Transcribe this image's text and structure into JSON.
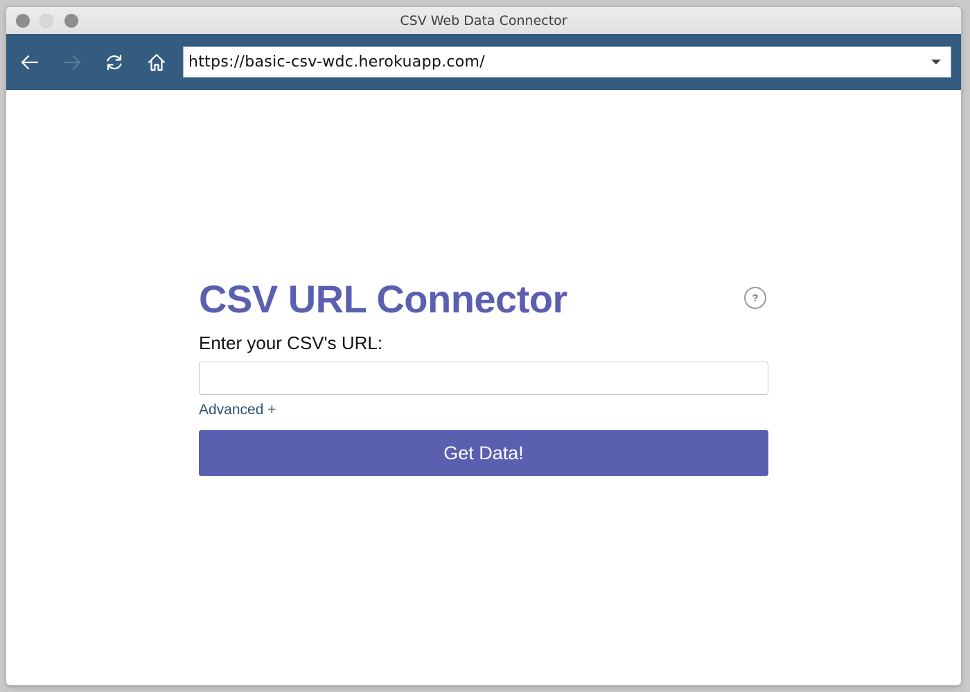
{
  "window": {
    "title": "CSV Web Data Connector"
  },
  "toolbar": {
    "back_icon": "arrow-left-icon",
    "forward_icon": "arrow-right-icon",
    "reload_icon": "reload-icon",
    "home_icon": "home-icon",
    "address": "https://basic-csv-wdc.herokuapp.com/"
  },
  "connector": {
    "title": "CSV URL Connector",
    "help_label": "?",
    "url_label": "Enter your CSV's URL:",
    "url_value": "",
    "advanced_label": "Advanced +",
    "submit_label": "Get Data!"
  },
  "colors": {
    "toolbar_bg": "#335c80",
    "accent": "#5a5fb0",
    "link": "#2f5470"
  }
}
